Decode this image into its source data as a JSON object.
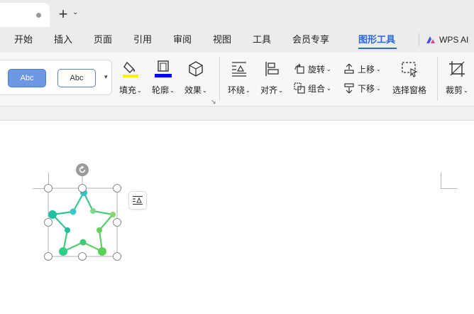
{
  "titlebar": {
    "new_tab_icon": "plus-icon",
    "new_tab_glyph": "+",
    "new_tab_menu_glyph": "⌄"
  },
  "menu": {
    "tabs": [
      {
        "label": "开始"
      },
      {
        "label": "插入"
      },
      {
        "label": "页面"
      },
      {
        "label": "引用"
      },
      {
        "label": "审阅"
      },
      {
        "label": "视图"
      },
      {
        "label": "工具"
      },
      {
        "label": "会员专享"
      },
      {
        "label": "图形工具",
        "active": true
      }
    ],
    "ai_label": "WPS AI"
  },
  "ribbon": {
    "styles": [
      {
        "label": "Abc"
      },
      {
        "label": "Abc"
      }
    ],
    "fill_label": "填充",
    "outline_label": "轮廓",
    "effect_label": "效果",
    "wrap_label": "环绕",
    "align_label": "对齐",
    "rotate_label": "旋转",
    "group_label": "组合",
    "bring_forward_label": "上移",
    "send_backward_label": "下移",
    "selection_pane_label": "选择窗格",
    "crop_label": "裁剪",
    "caret": "⌄",
    "fill_color": "#ffee00",
    "outline_color": "#0000ff"
  },
  "colors": {
    "accent": "#2a6ad8",
    "star_teal": "#1fbfb0",
    "star_green": "#5fcf5f"
  }
}
